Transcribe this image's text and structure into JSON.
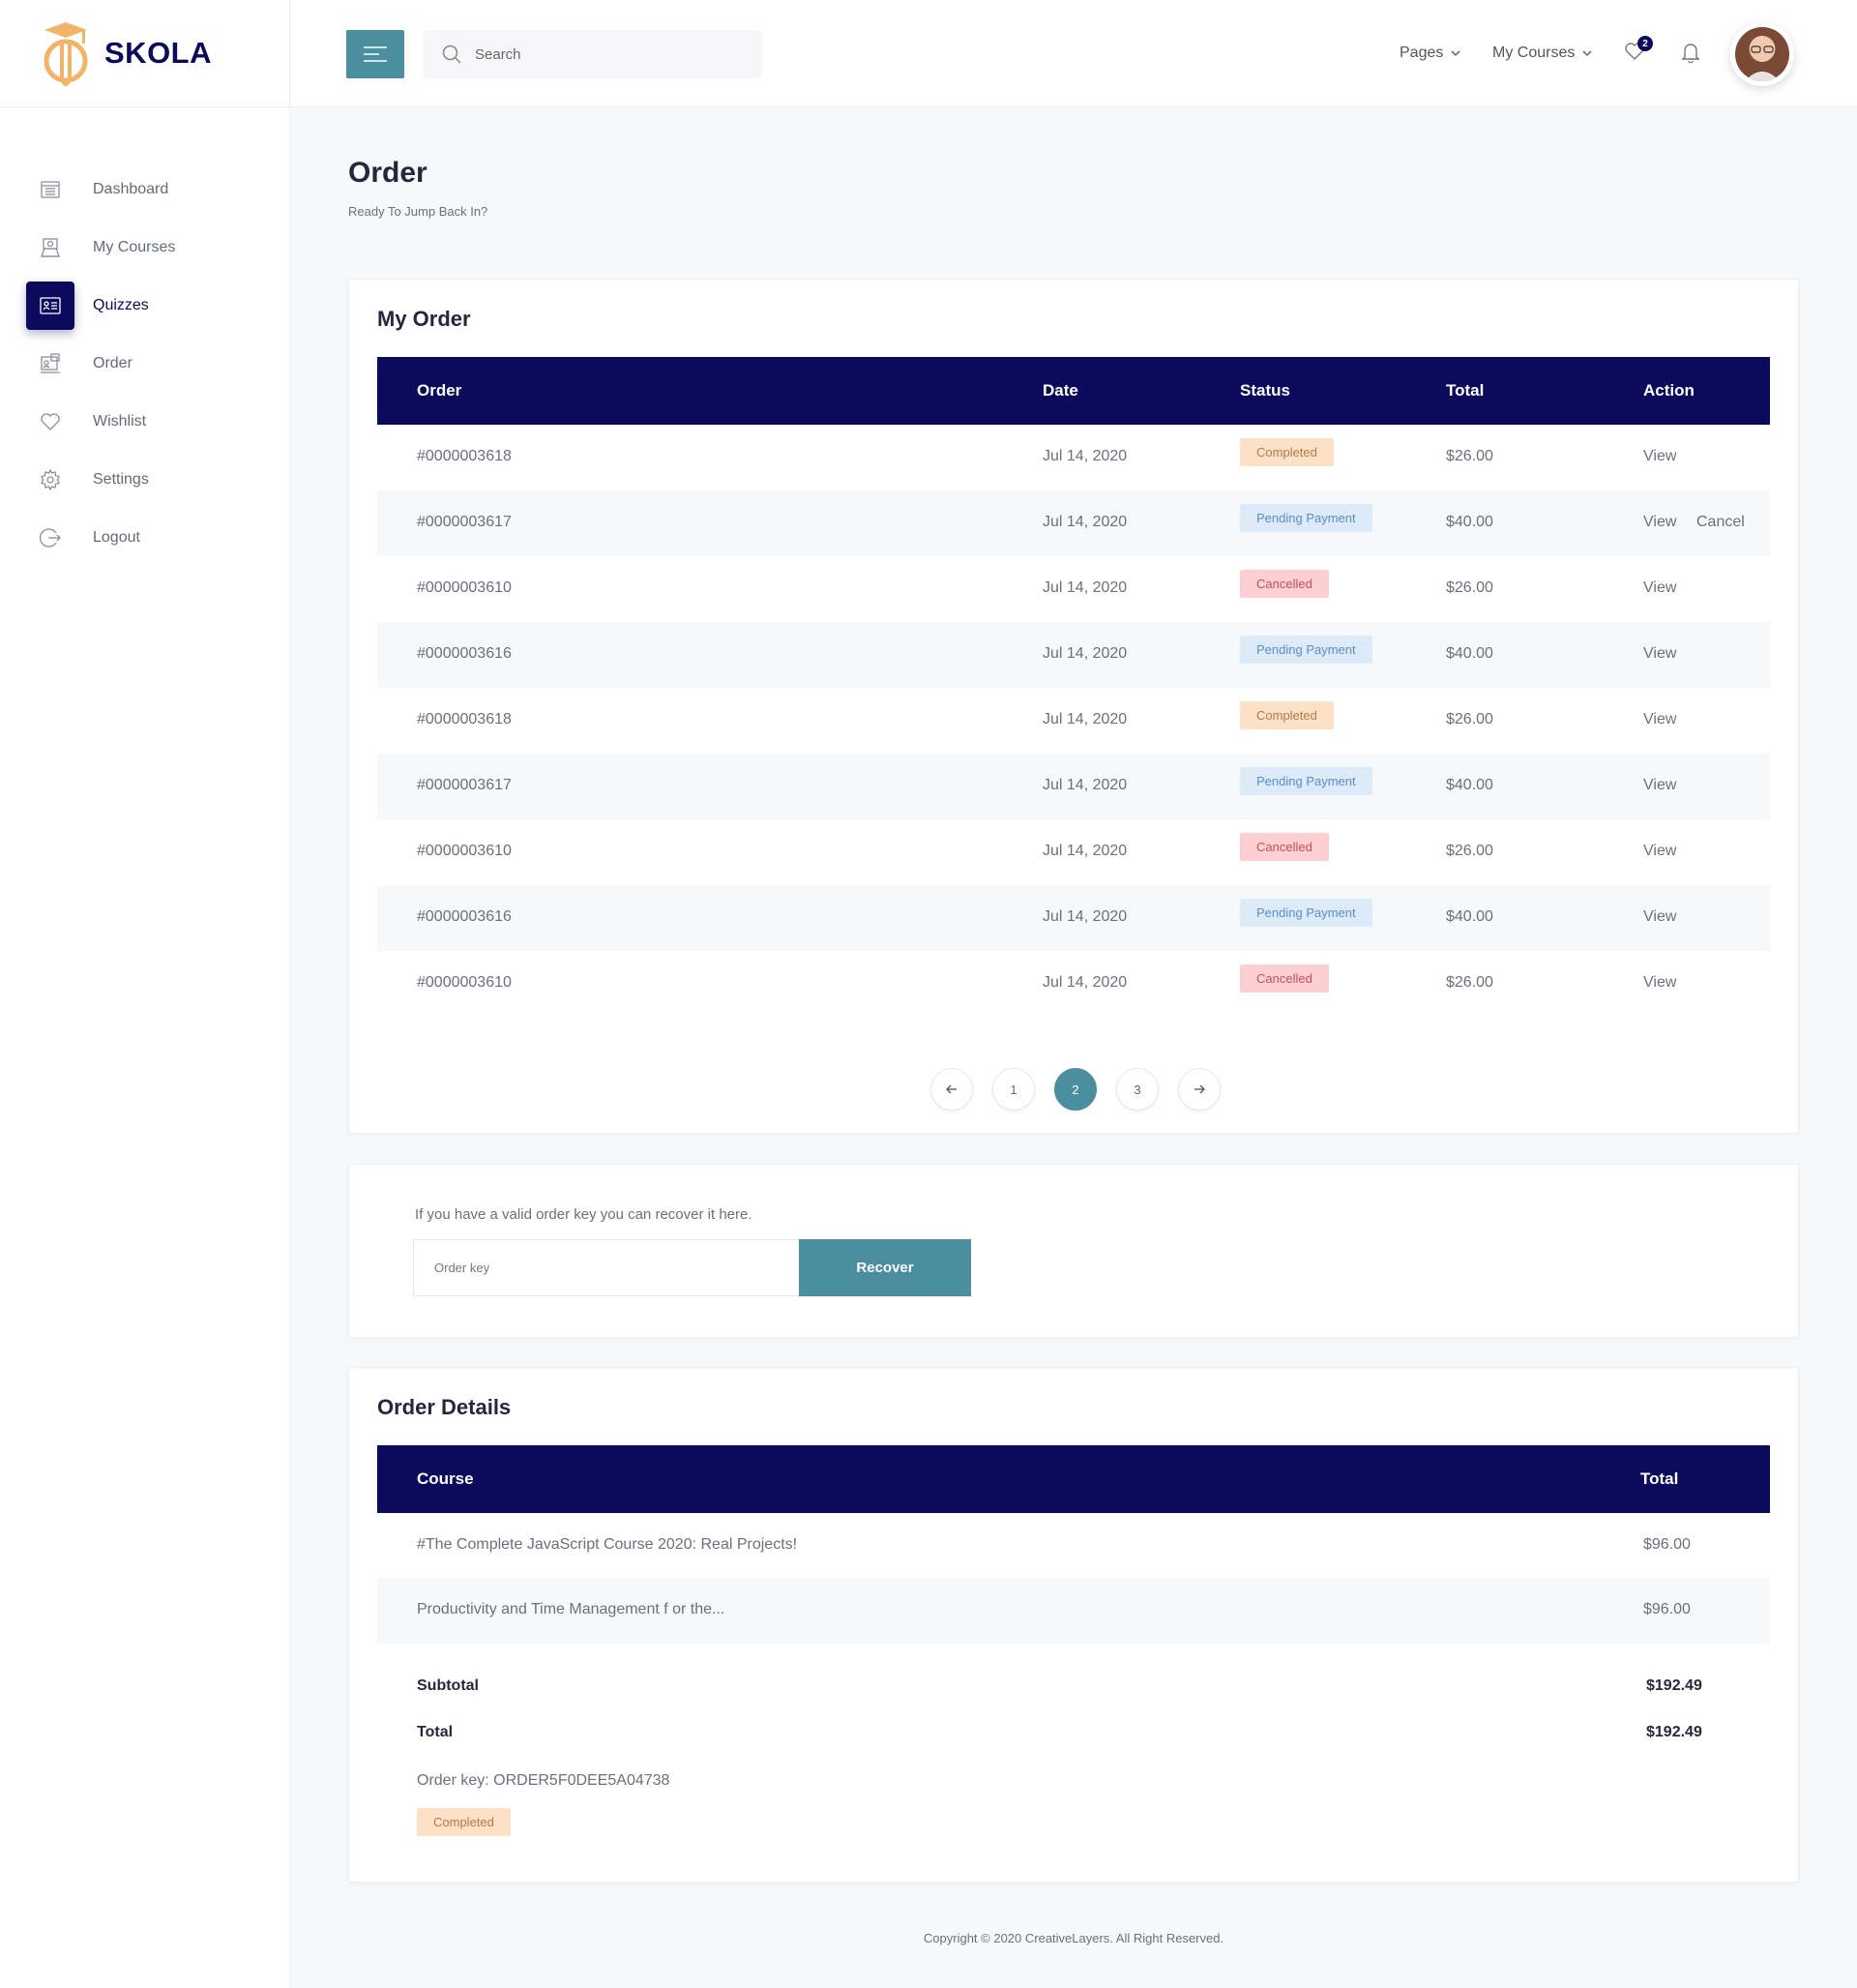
{
  "brand": {
    "name": "SKOLA"
  },
  "colors": {
    "navy": "#0b0a5c",
    "teal": "#4b8e9e",
    "logo_orange": "#f3b46a"
  },
  "sidebar": {
    "items": [
      {
        "label": "Dashboard",
        "icon": "dashboard-icon"
      },
      {
        "label": "My Courses",
        "icon": "courses-icon"
      },
      {
        "label": "Quizzes",
        "icon": "quiz-icon",
        "active": true
      },
      {
        "label": "Order",
        "icon": "order-icon"
      },
      {
        "label": "Wishlist",
        "icon": "heart-icon"
      },
      {
        "label": "Settings",
        "icon": "gear-icon"
      },
      {
        "label": "Logout",
        "icon": "logout-icon"
      }
    ]
  },
  "header": {
    "search_placeholder": "Search",
    "pages_label": "Pages",
    "my_courses_label": "My Courses",
    "wishlist_count": "2"
  },
  "page": {
    "title": "Order",
    "subtitle": "Ready To Jump Back In?"
  },
  "orders": {
    "title": "My Order",
    "columns": [
      "Order",
      "Date",
      "Status",
      "Total",
      "Action"
    ],
    "rows": [
      {
        "order": "#0000003618",
        "date": "Jul 14, 2020",
        "status": "Completed",
        "status_type": "completed",
        "total": "$26.00",
        "action": "View"
      },
      {
        "order": "#0000003617",
        "date": "Jul 14, 2020",
        "status": "Pending Payment",
        "status_type": "pending",
        "total": "$40.00",
        "action": "View",
        "action2": "Cancel"
      },
      {
        "order": "#0000003610",
        "date": "Jul 14, 2020",
        "status": "Cancelled",
        "status_type": "cancelled",
        "total": "$26.00",
        "action": "View"
      },
      {
        "order": "#0000003616",
        "date": "Jul 14, 2020",
        "status": "Pending Payment",
        "status_type": "pending",
        "total": "$40.00",
        "action": "View"
      },
      {
        "order": "#0000003618",
        "date": "Jul 14, 2020",
        "status": "Completed",
        "status_type": "completed",
        "total": "$26.00",
        "action": "View"
      },
      {
        "order": "#0000003617",
        "date": "Jul 14, 2020",
        "status": "Pending Payment",
        "status_type": "pending",
        "total": "$40.00",
        "action": "View"
      },
      {
        "order": "#0000003610",
        "date": "Jul 14, 2020",
        "status": "Cancelled",
        "status_type": "cancelled",
        "total": "$26.00",
        "action": "View"
      },
      {
        "order": "#0000003616",
        "date": "Jul 14, 2020",
        "status": "Pending Payment",
        "status_type": "pending",
        "total": "$40.00",
        "action": "View"
      },
      {
        "order": "#0000003610",
        "date": "Jul 14, 2020",
        "status": "Cancelled",
        "status_type": "cancelled",
        "total": "$26.00",
        "action": "View"
      }
    ],
    "pagination": {
      "pages": [
        "1",
        "2",
        "3"
      ],
      "current": "2"
    }
  },
  "recover": {
    "text": "If you have a valid order key you can recover it here.",
    "input_placeholder": "Order key",
    "button_label": "Recover"
  },
  "details": {
    "title": "Order Details",
    "columns": [
      "Course",
      "Total"
    ],
    "rows": [
      {
        "course": "#The Complete JavaScript Course 2020: Real Projects!",
        "total": "$96.00"
      },
      {
        "course": "Productivity and Time Management f or the...",
        "total": "$96.00"
      }
    ],
    "subtotal_label": "Subtotal",
    "subtotal_value": "$192.49",
    "total_label": "Total",
    "total_value": "$192.49",
    "order_key": "Order key: ORDER5F0DEE5A04738",
    "status": "Completed"
  },
  "footer": {
    "copyright": "Copyright © 2020 CreativeLayers. All Right Reserved."
  }
}
